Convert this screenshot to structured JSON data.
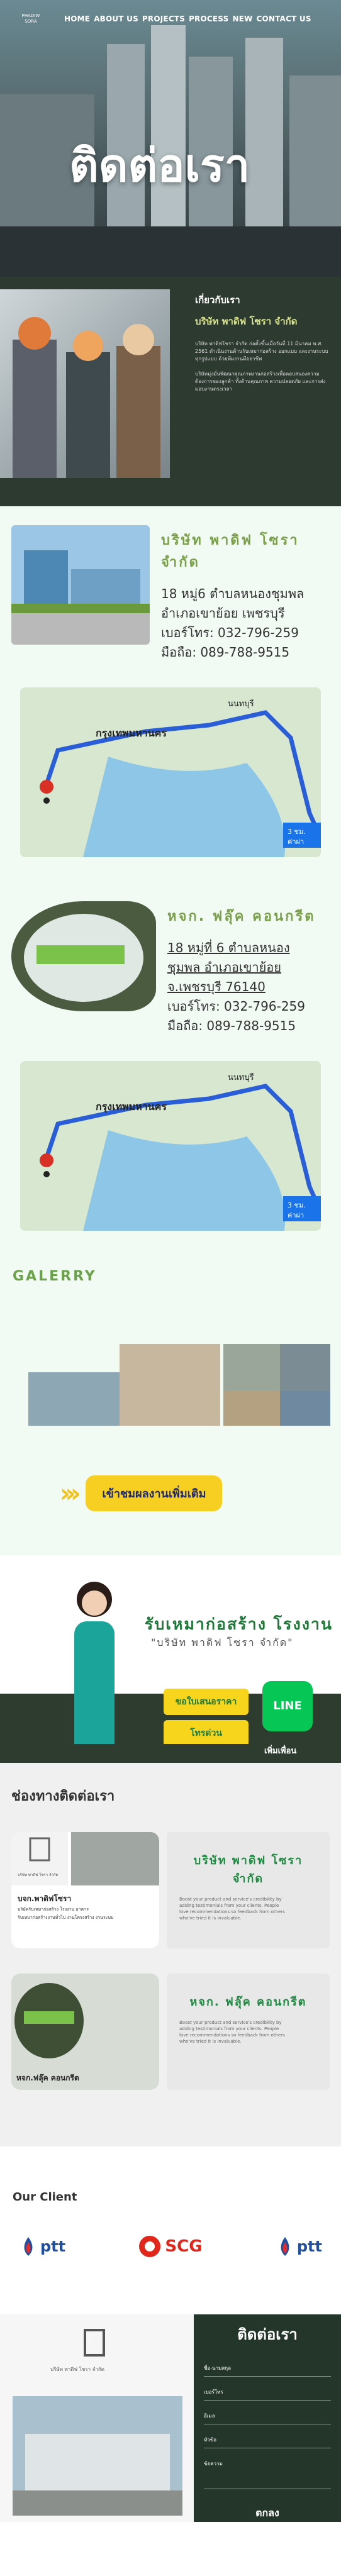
{
  "nav": {
    "logo_line1": "PHADIW",
    "logo_line2": "SORA",
    "menu": [
      "HOME",
      "ABOUT US",
      "PROJECTS",
      "PROCESS",
      "NEW",
      "CONTACT US"
    ]
  },
  "hero": {
    "title": "ติดต่อเรา"
  },
  "about": {
    "heading": "เกี่ยวกับเรา",
    "company": "บริษัท พาดิฟ โซรา จำกัด",
    "p1": "บริษัท พาดิฟโซรา จำกัด ก่อตั้งขึ้นเมื่อวันที่ 11 มีนาคม พ.ศ. 2561 ดำเนินงานด้านรับเหมาก่อสร้าง ออกแบบ และงานระบบทุกรูปแบบ ด้วยทีมงานมืออาชีพ",
    "p2": "บริษัทมุ่งมั่นพัฒนาคุณภาพงานก่อสร้างเพื่อตอบสนองความต้องการของลูกค้า ทั้งด้านคุณภาพ ความปลอดภัย และการส่งมอบงานตรงเวลา"
  },
  "company1": {
    "name": "บริษัท พาดิฟ โซรา จำกัด",
    "addr1": "18 หมู่6 ตำบลหนองชุมพล",
    "addr2": "อำเภอเขาย้อย เพชรบุรี",
    "tel": "เบอร์โทร: 032-796-259",
    "mobile": "มือถือ: 089-788-9515"
  },
  "company2": {
    "name": "หจก. ฟลุ๊ค คอนกรีต",
    "addr1": "18 หมู่ที่ 6 ตำบลหนอง",
    "addr2": "ชุมพล อำเภอเขาย้อย",
    "addr3": "จ.เพชรบุรี 76140",
    "tel": "เบอร์โทร: 032-796-259",
    "mobile": "มือถือ: 089-788-9515"
  },
  "map": {
    "city": "กรุงเทพมหานคร",
    "place": "นนทบุรี",
    "route_time": "3 ชม.",
    "route_dist": "ค่าผ่า"
  },
  "gallery": {
    "title": "GALERRY",
    "more": "เข้าชมผลงานเพิ่มเติม"
  },
  "promo": {
    "title": "รับเหมาก่อสร้าง โรงงาน",
    "sub": "\"บริษัท พาดิฟ โซรา จำกัด\"",
    "btn1": "ขอใบเสนอราคา",
    "btn2": "โทรด่วน",
    "line_label": "LINE",
    "line_sub": "เพิ่มเพื่อน"
  },
  "contact": {
    "title": "ช่องทางติดต่อเรา",
    "card1": {
      "logo_text": "บริษัท พาดิฟ โซรา จำกัด",
      "name": "บจก.พาดิฟโซรา",
      "sub": "บริษัทรับเหมาก่อสร้าง โรงงาน อาคาร",
      "desc": "รับเหมาก่อสร้างงานทั่วไป งานโครงสร้าง งานระบบ",
      "right_name": "บริษัท พาดิฟ โซรา จำกัด",
      "right_desc": "Boost your product and service's credibility by adding testimonials from your clients. People love recommendations so feedback from others who've tried it is invaluable."
    },
    "card2": {
      "name": "หจก.ฟลุ๊ค คอนกรีต",
      "right_name": "หจก. ฟลุ๊ค คอนกรีต",
      "right_desc": "Boost your product and service's credibility by adding testimonials from your clients. People love recommendations so feedback from others who've tried it is invaluable."
    }
  },
  "client": {
    "title": "Our Client",
    "logos": [
      "ptt",
      "SCG",
      "ptt"
    ]
  },
  "footer": {
    "logo_text": "บริษัท พาดิฟ โซรา จำกัด",
    "form_title": "ติดต่อเรา",
    "fields": [
      "ชื่อ-นามสกุล",
      "เบอร์โทร",
      "อีเมล",
      "หัวข้อ",
      "ข้อความ"
    ],
    "submit": "ตกลง"
  },
  "colors": {
    "dark_green": "#2d3a30",
    "accent_green": "#7aa14a",
    "yellow": "#f7ce22",
    "line_green": "#06c755"
  }
}
